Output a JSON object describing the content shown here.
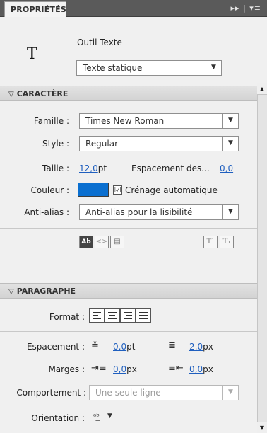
{
  "panel": {
    "tab_label": "PROPRIÉTÉS",
    "tab_controls": "▸▸ | ▾≡"
  },
  "tool": {
    "icon_glyph": "T",
    "name": "Outil Texte",
    "text_type": "Texte statique"
  },
  "character": {
    "header": "CARACTÈRE",
    "family_label": "Famille :",
    "family_value": "Times New Roman",
    "style_label": "Style :",
    "style_value": "Regular",
    "size_label": "Taille :",
    "size_value": "12,0",
    "size_unit": "pt",
    "spacing_label": "Espacement des...",
    "spacing_value": "0,0",
    "color_label": "Couleur :",
    "color_hex": "#0a6fd0",
    "kerning_label": "Crénage automatique",
    "kerning_checked": "☑",
    "antialias_label": "Anti-alias :",
    "antialias_value": "Anti-alias pour la lisibilité",
    "btn_selectable": "Ab",
    "btn_html": "<>",
    "btn_border": "▤",
    "btn_superscript": "T¹",
    "btn_subscript": "T₁"
  },
  "paragraph": {
    "header": "PARAGRAPHE",
    "format_label": "Format :",
    "spacing_label": "Espacement :",
    "indent_value": "0,0",
    "indent_unit": "pt",
    "line_spacing_value": "2,0",
    "line_spacing_unit": "px",
    "margins_label": "Marges :",
    "left_margin_value": "0,0",
    "left_margin_unit": "px",
    "right_margin_value": "0,0",
    "right_margin_unit": "px",
    "behavior_label": "Comportement :",
    "behavior_value": "Une seule ligne",
    "orientation_label": "Orientation :"
  },
  "icons": {
    "collapse": "▽",
    "dropdown": "▼",
    "scroll_up": "▲",
    "scroll_down": "▼"
  }
}
